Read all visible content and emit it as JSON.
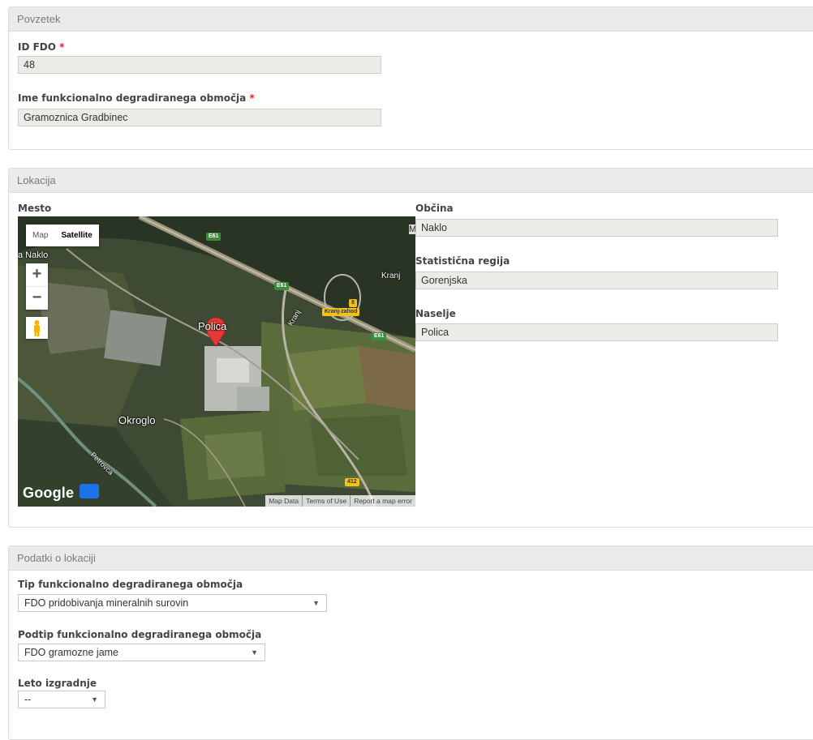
{
  "panels": {
    "povzetek": {
      "title": "Povzetek",
      "id_label": "ID FDO",
      "id_value": "48",
      "name_label": "Ime funkcionalno degradiranega območja",
      "name_value": "Gramoznica Gradbinec",
      "required_mark": "*"
    },
    "lokacija": {
      "title": "Lokacija",
      "mesto_label": "Mesto",
      "obcina_label": "Občina",
      "obcina_value": "Naklo",
      "regija_label": "Statistična regija",
      "regija_value": "Gorenjska",
      "naselje_label": "Naselje",
      "naselje_value": "Polica"
    },
    "podatki": {
      "title": "Podatki o lokaciji",
      "tip_label": "Tip funkcionalno degradiranega območja",
      "tip_value": "FDO pridobivanja mineralnih surovin",
      "podtip_label": "Podtip funkcionalno degradiranega območja",
      "podtip_value": "FDO gramozne jame",
      "leto_label": "Leto izgradnje",
      "leto_value": "--"
    }
  },
  "map": {
    "type_map": "Map",
    "type_satellite": "Satellite",
    "zoom_in": "+",
    "zoom_out": "−",
    "labels": {
      "naklo": "a Naklo",
      "polica": "Polica",
      "okroglo": "Okroglo",
      "kranj": "Kranj",
      "kranj_road": "Kranj",
      "kranj_zahod": "Kranj-zahod",
      "e61_a": "E61",
      "e61_b": "E61",
      "e61_c": "E61",
      "r412": "412",
      "exit8": "8",
      "petrovca": "Petrovca",
      "m_edge": "M"
    },
    "attribution": {
      "data": "Map Data",
      "terms": "Terms of Use",
      "report": "Report a map error"
    },
    "logo": "Google"
  },
  "colors": {
    "panel_header_bg": "#ebebeb",
    "required": "#d9242b",
    "marker": "#e53935",
    "readonly_field_bg": "#ebebe7"
  }
}
